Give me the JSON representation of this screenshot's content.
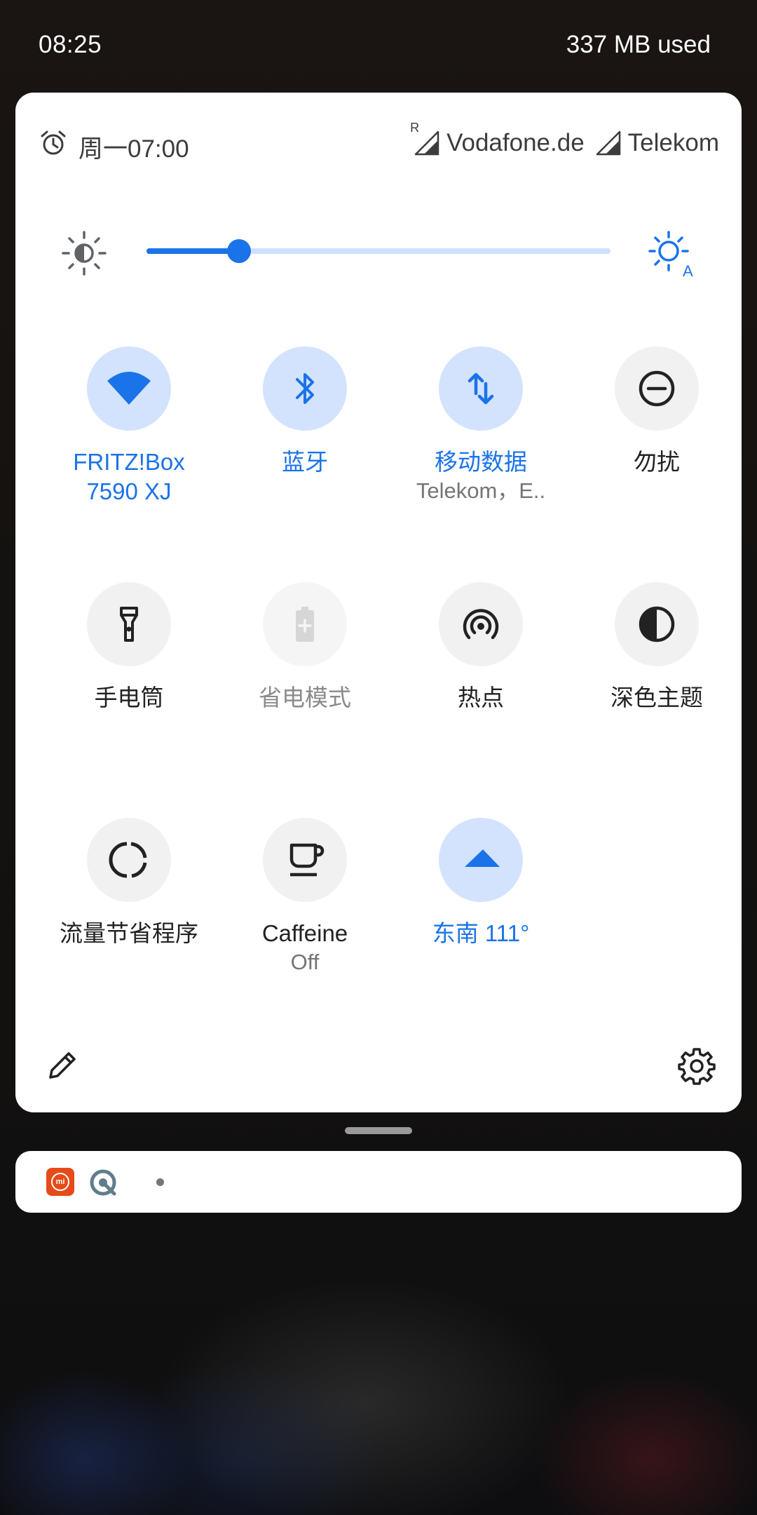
{
  "status_bar": {
    "time": "08:25",
    "memory": "337 MB used"
  },
  "header": {
    "alarm": "周一07:00",
    "alarm_icon": "alarm-clock-icon",
    "carriers": [
      {
        "name": "Vodafone.de",
        "roaming": "R",
        "icon": "signal-icon"
      },
      {
        "name": "Telekom",
        "icon": "signal-icon"
      }
    ]
  },
  "brightness": {
    "level": 0.2,
    "low_icon": "brightness-low-icon",
    "auto_icon": "brightness-auto-icon",
    "auto_letter": "A"
  },
  "tiles": [
    {
      "label": "FRITZ!Box\n7590 XJ",
      "icon": "wifi-icon",
      "state": "on"
    },
    {
      "label": "蓝牙",
      "icon": "bluetooth-icon",
      "state": "on"
    },
    {
      "label": "移动数据",
      "sub": "Telekom，E..",
      "icon": "mobile-data-icon",
      "state": "on"
    },
    {
      "label": "勿扰",
      "icon": "do-not-disturb-icon",
      "state": "off"
    },
    {
      "label": "手电筒",
      "icon": "flashlight-icon",
      "state": "off"
    },
    {
      "label": "省电模式",
      "icon": "battery-saver-icon",
      "state": "disabled"
    },
    {
      "label": "热点",
      "icon": "hotspot-icon",
      "state": "off"
    },
    {
      "label": "深色主题",
      "icon": "dark-theme-icon",
      "state": "off"
    },
    {
      "label": "流量节省程序",
      "icon": "data-saver-icon",
      "state": "off"
    },
    {
      "label": "Caffeine",
      "sub": "Off",
      "icon": "coffee-cup-icon",
      "state": "off"
    },
    {
      "label": "东南 111°",
      "icon": "compass-arrow-icon",
      "state": "on"
    }
  ],
  "footer": {
    "edit_icon": "pencil-icon",
    "settings_icon": "gear-icon"
  },
  "notifications": {
    "app_icons": [
      "mi-icon",
      "q-icon"
    ],
    "mi_text": "mi",
    "overflow": "more-dot"
  },
  "colors": {
    "accent": "#1a73e8",
    "tile_on": "#d3e3fd",
    "tile_off": "#f1f1f1"
  }
}
